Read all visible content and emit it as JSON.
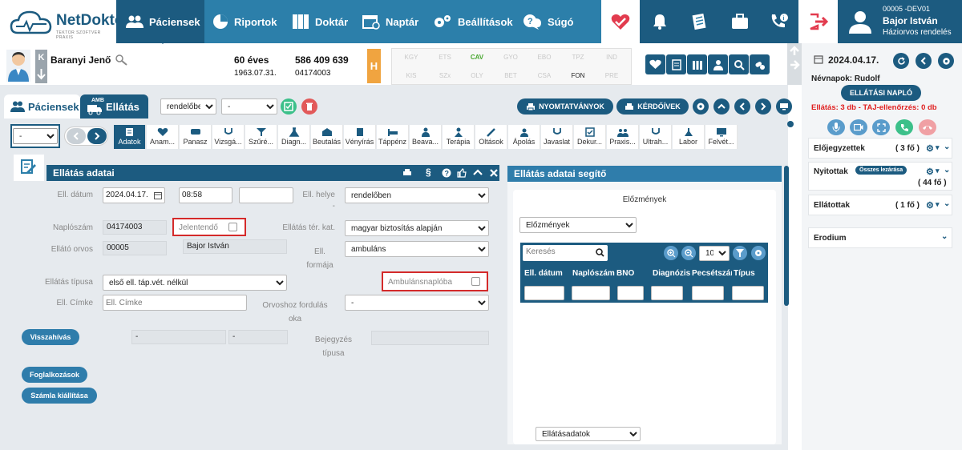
{
  "brand": {
    "name": "NetDoktor",
    "tagline": "TEKTOR SZOFTVER PRAXIS"
  },
  "nav": [
    {
      "label": "Páciensek",
      "icon": "users-icon"
    },
    {
      "label": "Riportok",
      "icon": "pie-chart-icon"
    },
    {
      "label": "Doktár",
      "icon": "binders-icon"
    },
    {
      "label": "Naptár",
      "icon": "calendar-icon"
    },
    {
      "label": "Beállítások",
      "icon": "gears-icon"
    },
    {
      "label": "Súgó",
      "icon": "help-chat-icon"
    }
  ],
  "user": {
    "code": "00005 -DEV01",
    "name": "Bajor István",
    "role": "Háziorvos rendelés"
  },
  "patient": {
    "name": "Baranyi Jenő",
    "age": "60 éves",
    "dob": "1963.07.31.",
    "taj": "586 409 639",
    "log_no": "04174003",
    "k_letter": "K",
    "badge": "H",
    "codes_row1": [
      "KGY",
      "ETS",
      "CAV",
      "GYO",
      "EBO",
      "TPZ",
      "IND"
    ],
    "codes_row2": [
      "KIS",
      "SZx",
      "OLY",
      "BET",
      "CSA",
      "FON",
      "PRE"
    ],
    "active_code_row1": "CAV",
    "active_code_row2": "FON"
  },
  "tabs": {
    "patients": "Páciensek",
    "care": "Ellátás",
    "care_badge": "AMB"
  },
  "filters": {
    "location": "rendelőben",
    "second": "-",
    "left_select": "-"
  },
  "buttons": {
    "print": "NYOMTATVÁNYOK",
    "questionnaires": "KÉRDŐÍVEK"
  },
  "toolbar": [
    "Adatok",
    "Anam...",
    "Panasz",
    "Vizsgá...",
    "Szűré...",
    "Diagn...",
    "Beutalás",
    "Vényírás",
    "Táppénz",
    "Beava...",
    "Terápia",
    "Oltások",
    "Ápolás",
    "Javaslat",
    "Dekur...",
    "Praxis...",
    "Ultrah...",
    "Labor",
    "Felvét..."
  ],
  "form": {
    "title": "Ellátás adatai",
    "date_label": "Ell. dátum",
    "date_value": "2024.04.17.",
    "time_value": "08:58",
    "extra_value": "",
    "place_label": "Ell. helye",
    "place_value": "rendelőben",
    "log_label": "Naplószám",
    "log_value": "04174003",
    "reportable_label": "Jelentendő",
    "coverage_label": "Ellátás tér. kat.",
    "coverage_value": "magyar biztosítás alapján",
    "doctor_label": "Ellátó orvos",
    "doctor_code": "00005",
    "doctor_name": "Bajor István",
    "form_label": "Ell. formája",
    "form_value": "ambuláns",
    "type_label": "Ellátás típusa",
    "type_value": "első ell. táp.vét. nélkül",
    "amb_label": "Ambulánsnaplóba",
    "tag_label": "Ell. Címke",
    "tag_placeholder": "Ell. Címke",
    "reason_label": "Orvoshoz fordulás oka",
    "reason_value": "-",
    "recall_button": "Visszahívás",
    "recall_a": "-",
    "recall_b": "-",
    "entry_label": "Bejegyzés típusa",
    "occupation_button": "Foglalkozások",
    "invoice_button": "Számla kiállítása"
  },
  "helper": {
    "title": "Ellátás adatai segítő",
    "history_title": "Előzmények",
    "history_select": "Előzmények",
    "search_placeholder": "Keresés",
    "page_size": "10",
    "columns": [
      "Ell. dátum",
      "Naplószám",
      "BNO",
      "Diagnózis",
      "Pecsétszám",
      "Típus"
    ],
    "bottom_select": "Ellátásadatok"
  },
  "right": {
    "date": "2024.04.17.",
    "namedays": "Névnapok: Rudolf",
    "log_button": "ELLÁTÁSI NAPLÓ",
    "alert": "Ellátás: 3 db - TAJ-ellenőrzés: 0 db",
    "preorders_label": "Előjegyzettek",
    "preorders_count": "( 3 fő )",
    "open_label": "Nyitottak",
    "close_all": "Összes lezárása",
    "open_count": "( 44 fő )",
    "served_label": "Ellátottak",
    "served_count": "( 1 fő )",
    "erodium_label": "Erodium"
  },
  "colors": {
    "primary": "#1c5b80",
    "nav": "#2c7faa",
    "accent_orange": "#f0a440",
    "alert_red": "#e02020",
    "highlight_box": "#d42a2a"
  }
}
